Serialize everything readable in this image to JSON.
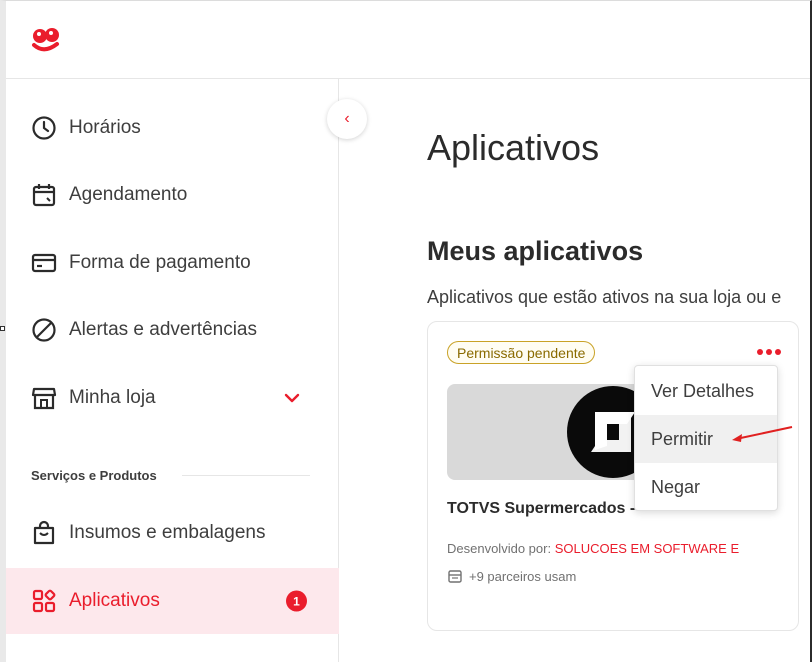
{
  "brand": {
    "accent": "#ea1d2c",
    "active_bg": "#fde8ec"
  },
  "sidebar": {
    "items": [
      {
        "label": "Horários",
        "icon": "clock-icon"
      },
      {
        "label": "Agendamento",
        "icon": "calendar-icon"
      },
      {
        "label": "Forma de pagamento",
        "icon": "credit-card-icon"
      },
      {
        "label": "Alertas e advertências",
        "icon": "prohibited-icon"
      },
      {
        "label": "Minha loja",
        "icon": "store-icon",
        "expandable": true
      }
    ],
    "section_title": "Serviços e Produtos",
    "section_items": [
      {
        "label": "Insumos e embalagens",
        "icon": "shopping-bag-icon"
      },
      {
        "label": "Aplicativos",
        "icon": "apps-grid-icon",
        "active": true,
        "badge": "1"
      }
    ]
  },
  "collapse_button": {
    "icon": "chevron-left-icon",
    "glyph": "‹"
  },
  "main": {
    "title": "Aplicativos",
    "section_heading": "Meus aplicativos",
    "section_subtitle": "Aplicativos que estão ativos na sua loja ou e"
  },
  "app_card": {
    "status": "Permissão pendente",
    "name": "TOTVS Supermercados -",
    "developer_prefix": "Desenvolvido por:",
    "developer": "SOLUCOES EM SOFTWARE E",
    "partners": "+9 parceiros usam",
    "menu_icon": "more-dots-icon"
  },
  "dropdown": {
    "items": [
      "Ver Detalhes",
      "Permitir",
      "Negar"
    ],
    "highlighted": "Permitir"
  }
}
